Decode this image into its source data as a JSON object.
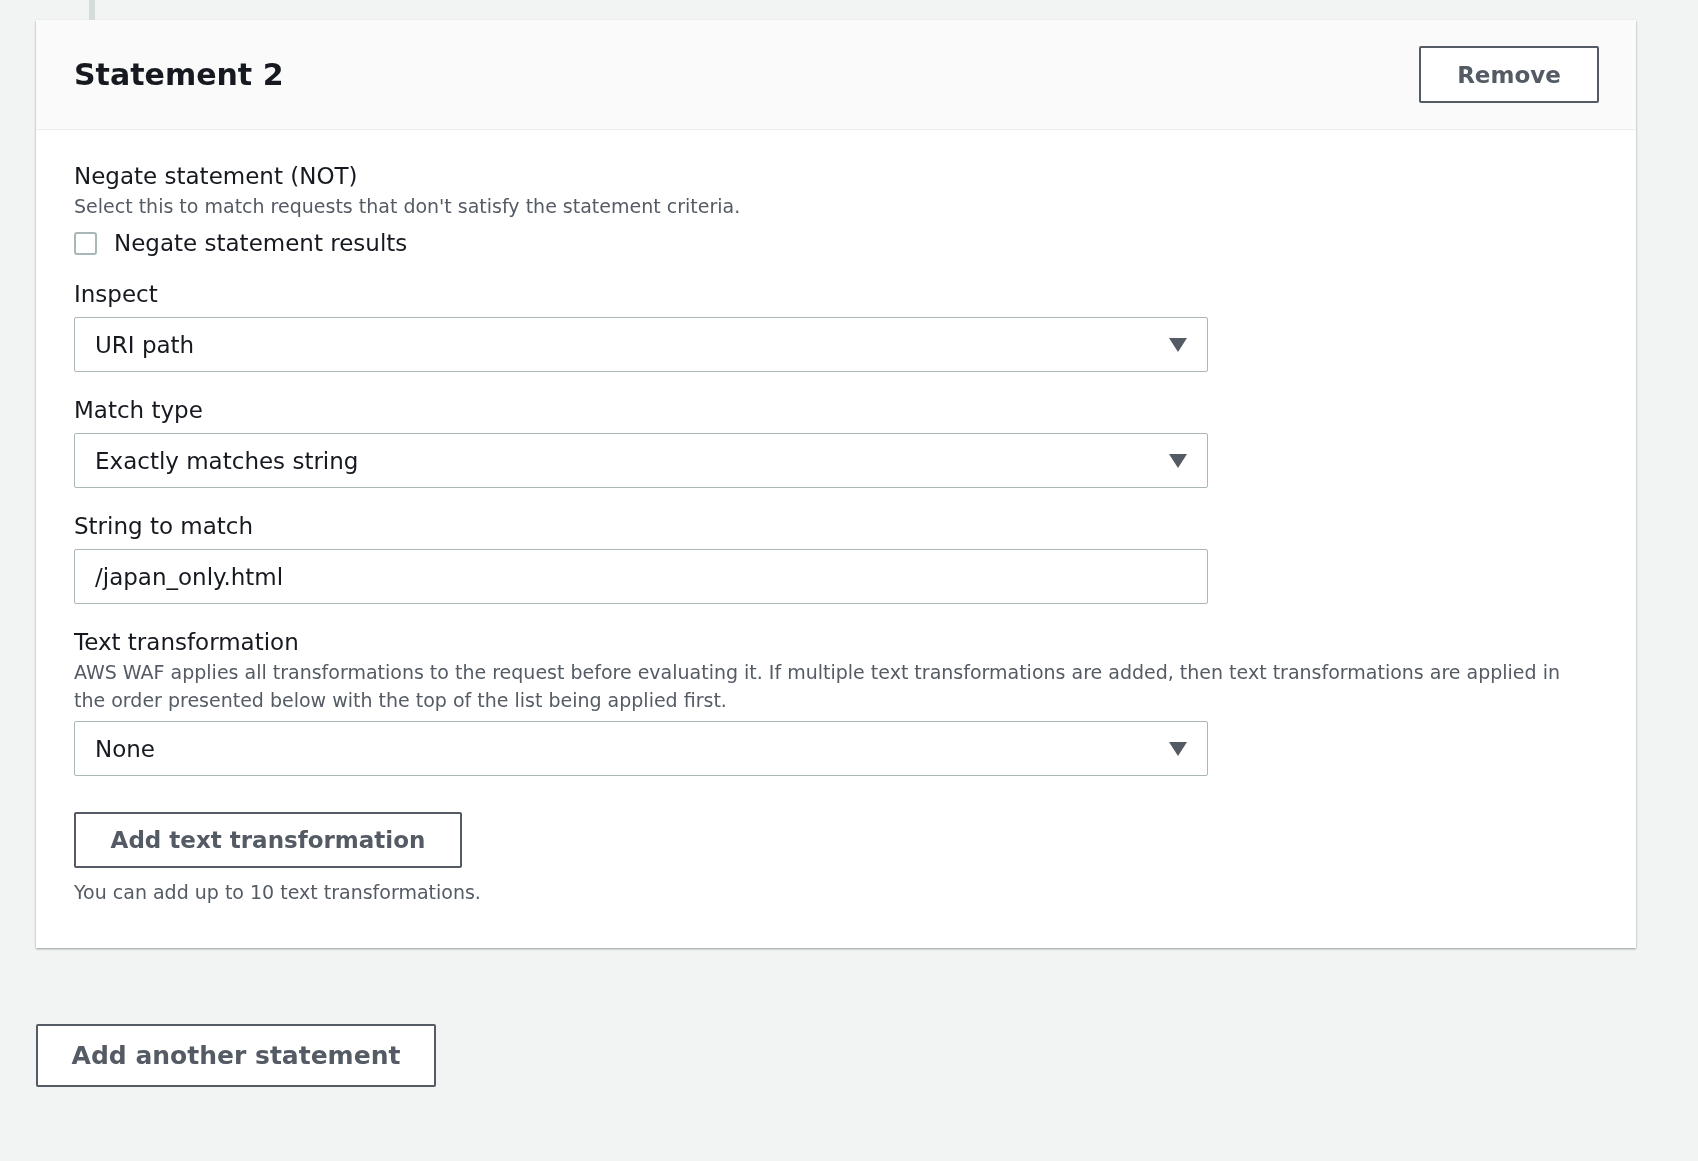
{
  "statement": {
    "title": "Statement 2",
    "remove_button": "Remove",
    "negate": {
      "label": "Negate statement (NOT)",
      "description": "Select this to match requests that don't satisfy the statement criteria.",
      "checkbox_label": "Negate statement results",
      "checked": false
    },
    "fields": [
      {
        "kind": "select",
        "label": "Inspect",
        "value": "URI path"
      },
      {
        "kind": "select",
        "label": "Match type",
        "value": "Exactly matches string"
      },
      {
        "kind": "input",
        "label": "String to match",
        "value": "/japan_only.html"
      },
      {
        "kind": "select",
        "label": "Text transformation",
        "description": "AWS WAF applies all transformations to the request before evaluating it. If multiple text transformations are added, then text transformations are applied in the order presented below with the top of the list being applied first.",
        "value": "None"
      }
    ],
    "add_transformation_button": "Add text transformation",
    "hint": "You can add up to 10 text transformations."
  },
  "add_statement_button": "Add another statement"
}
